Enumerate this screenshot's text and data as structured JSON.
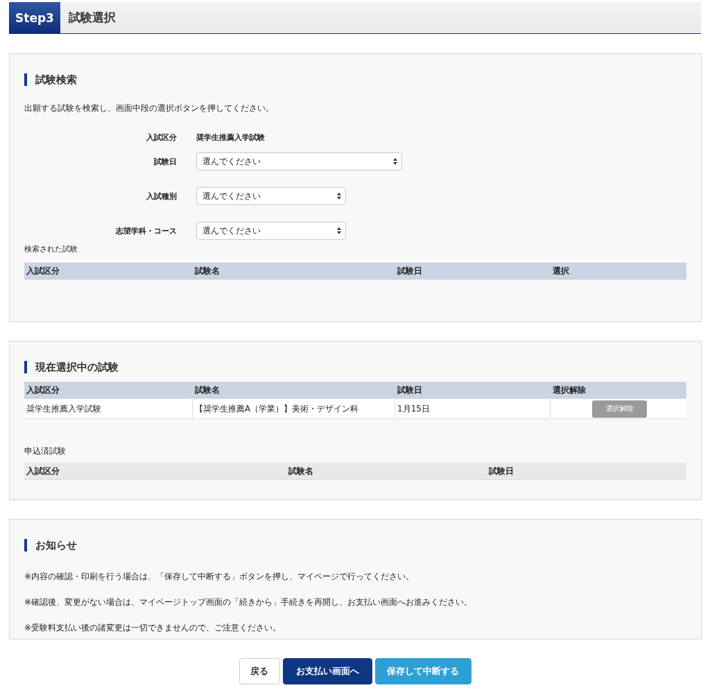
{
  "header": {
    "step": "Step3",
    "title": "試験選択"
  },
  "search": {
    "heading": "試験検索",
    "description": "出願する試験を検索し、画面中段の選択ボタンを押してください。",
    "fields": [
      {
        "kind": "static",
        "label": "入試区分",
        "value": "奨学生推薦入学試験"
      },
      {
        "kind": "select",
        "label": "試験日",
        "placeholder": "選んでください",
        "wide": true
      },
      {
        "kind": "select",
        "label": "入試種別",
        "placeholder": "選んでください",
        "wide": false
      },
      {
        "kind": "select",
        "label": "志望学科・コース",
        "placeholder": "選んでください",
        "wide": false
      }
    ],
    "results_label": "検索された試験",
    "results_table": {
      "columns": [
        "入試区分",
        "試験名",
        "試験日",
        "選択"
      ]
    }
  },
  "current": {
    "heading": "現在選択中の試験",
    "table": {
      "columns": [
        "入試区分",
        "試験名",
        "試験日",
        "選択解除"
      ],
      "rows": [
        {
          "cells": [
            "奨学生推薦入学試験",
            "【奨学生推薦A（学業）】美術・デザイン科",
            "1月15日"
          ],
          "button": "選択解除",
          "disabled": true
        }
      ]
    },
    "applied_label": "申込済試験",
    "applied_table": {
      "columns": [
        "入試区分",
        "試験名",
        "試験日"
      ]
    }
  },
  "notice": {
    "heading": "お知らせ",
    "lines": [
      "※内容の確認・印刷を行う場合は、「保存して中断する」ボタンを押し、マイページで行ってください。",
      "※確認後、変更がない場合は、マイページトップ画面の「続きから」手続きを再開し、お支払い画面へお進みください。",
      "※受験料支払い後の諸変更は一切できませんので、ご注意ください。"
    ]
  },
  "buttons": [
    {
      "label": "戻る",
      "kind": "back"
    },
    {
      "label": "お支払い画面へ",
      "kind": "primary"
    },
    {
      "label": "保存して中断する",
      "kind": "save"
    }
  ]
}
